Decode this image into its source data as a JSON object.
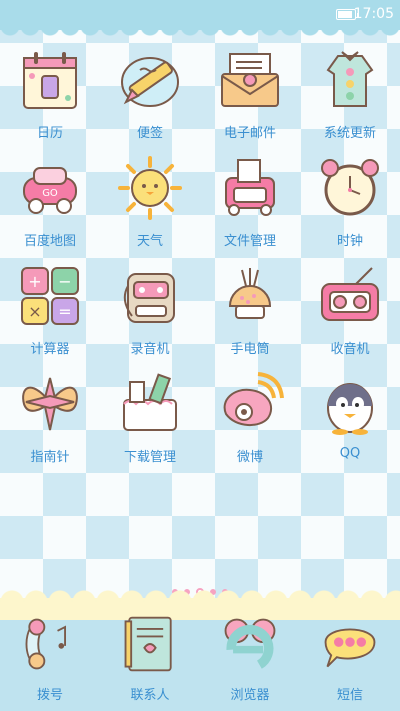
{
  "status": {
    "time": "17:05",
    "battery_level": 0.9
  },
  "apps": [
    {
      "label": "日历",
      "icon": "calendar-icon"
    },
    {
      "label": "便签",
      "icon": "notes-icon"
    },
    {
      "label": "电子邮件",
      "icon": "email-icon"
    },
    {
      "label": "系统更新",
      "icon": "system-update-icon"
    },
    {
      "label": "百度地图",
      "icon": "map-icon"
    },
    {
      "label": "天气",
      "icon": "weather-icon"
    },
    {
      "label": "文件管理",
      "icon": "file-manager-icon"
    },
    {
      "label": "时钟",
      "icon": "clock-icon"
    },
    {
      "label": "计算器",
      "icon": "calculator-icon"
    },
    {
      "label": "录音机",
      "icon": "recorder-icon"
    },
    {
      "label": "手电筒",
      "icon": "flashlight-icon"
    },
    {
      "label": "收音机",
      "icon": "radio-icon"
    },
    {
      "label": "指南针",
      "icon": "compass-icon"
    },
    {
      "label": "下载管理",
      "icon": "download-manager-icon"
    },
    {
      "label": "微博",
      "icon": "weibo-icon"
    },
    {
      "label": "QQ",
      "icon": "qq-icon"
    }
  ],
  "page_indicator": {
    "count": 5,
    "active": 2
  },
  "dock": [
    {
      "label": "拨号",
      "icon": "phone-icon"
    },
    {
      "label": "联系人",
      "icon": "contacts-icon"
    },
    {
      "label": "浏览器",
      "icon": "browser-icon"
    },
    {
      "label": "短信",
      "icon": "messages-icon"
    }
  ],
  "colors": {
    "label": "#3a8fd0",
    "accent_pink": "#f6a3c1",
    "status_bar": "#a9dcea"
  }
}
